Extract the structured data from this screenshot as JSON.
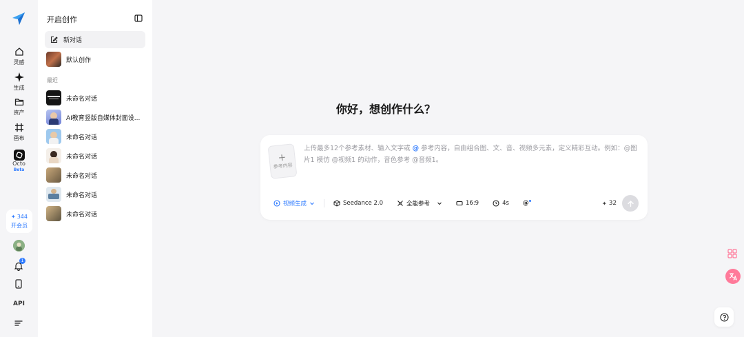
{
  "rail": {
    "items": [
      {
        "label": "灵感",
        "icon": "home-icon"
      },
      {
        "label": "生成",
        "icon": "sparkle-icon"
      },
      {
        "label": "资产",
        "icon": "folder-icon"
      },
      {
        "label": "画布",
        "icon": "canvas-icon"
      },
      {
        "label": "Octo",
        "icon": "octo-icon",
        "badge": "Beta"
      }
    ],
    "credits": "344",
    "vip_label": "开会员",
    "notification_count": "1",
    "api_label": "API"
  },
  "sidebar": {
    "title": "开启创作",
    "new_chat": "新对话",
    "default_item": "默认创作",
    "recent_label": "最近",
    "recent": [
      {
        "label": "未命名对话"
      },
      {
        "label": "AI教育竖版自媒体封面设..."
      },
      {
        "label": "未命名对话"
      },
      {
        "label": "未命名对话"
      },
      {
        "label": "未命名对话"
      },
      {
        "label": "未命名对话"
      },
      {
        "label": "未命名对话"
      }
    ]
  },
  "main": {
    "greeting": "你好，想创作什么？",
    "ref_card_label": "参考内容",
    "placeholder_pre": "上传最多12个参考素材、输入文字或",
    "placeholder_at": "@",
    "placeholder_post": "参考内容，自由组合图、文、音、视频多元素，定义精彩互动。例如：@图片1 模仿 @视频1 的动作，音色参考 @音频1。",
    "toolbar": {
      "mode": "视频生成",
      "model": "Seedance 2.0",
      "reference": "全能参考",
      "ratio": "16:9",
      "duration": "4s",
      "mention": "@"
    },
    "credit_cost": "32"
  },
  "colors": {
    "accent": "#2f7bff",
    "background": "#f5f5f7",
    "sidebar": "#ffffff"
  }
}
